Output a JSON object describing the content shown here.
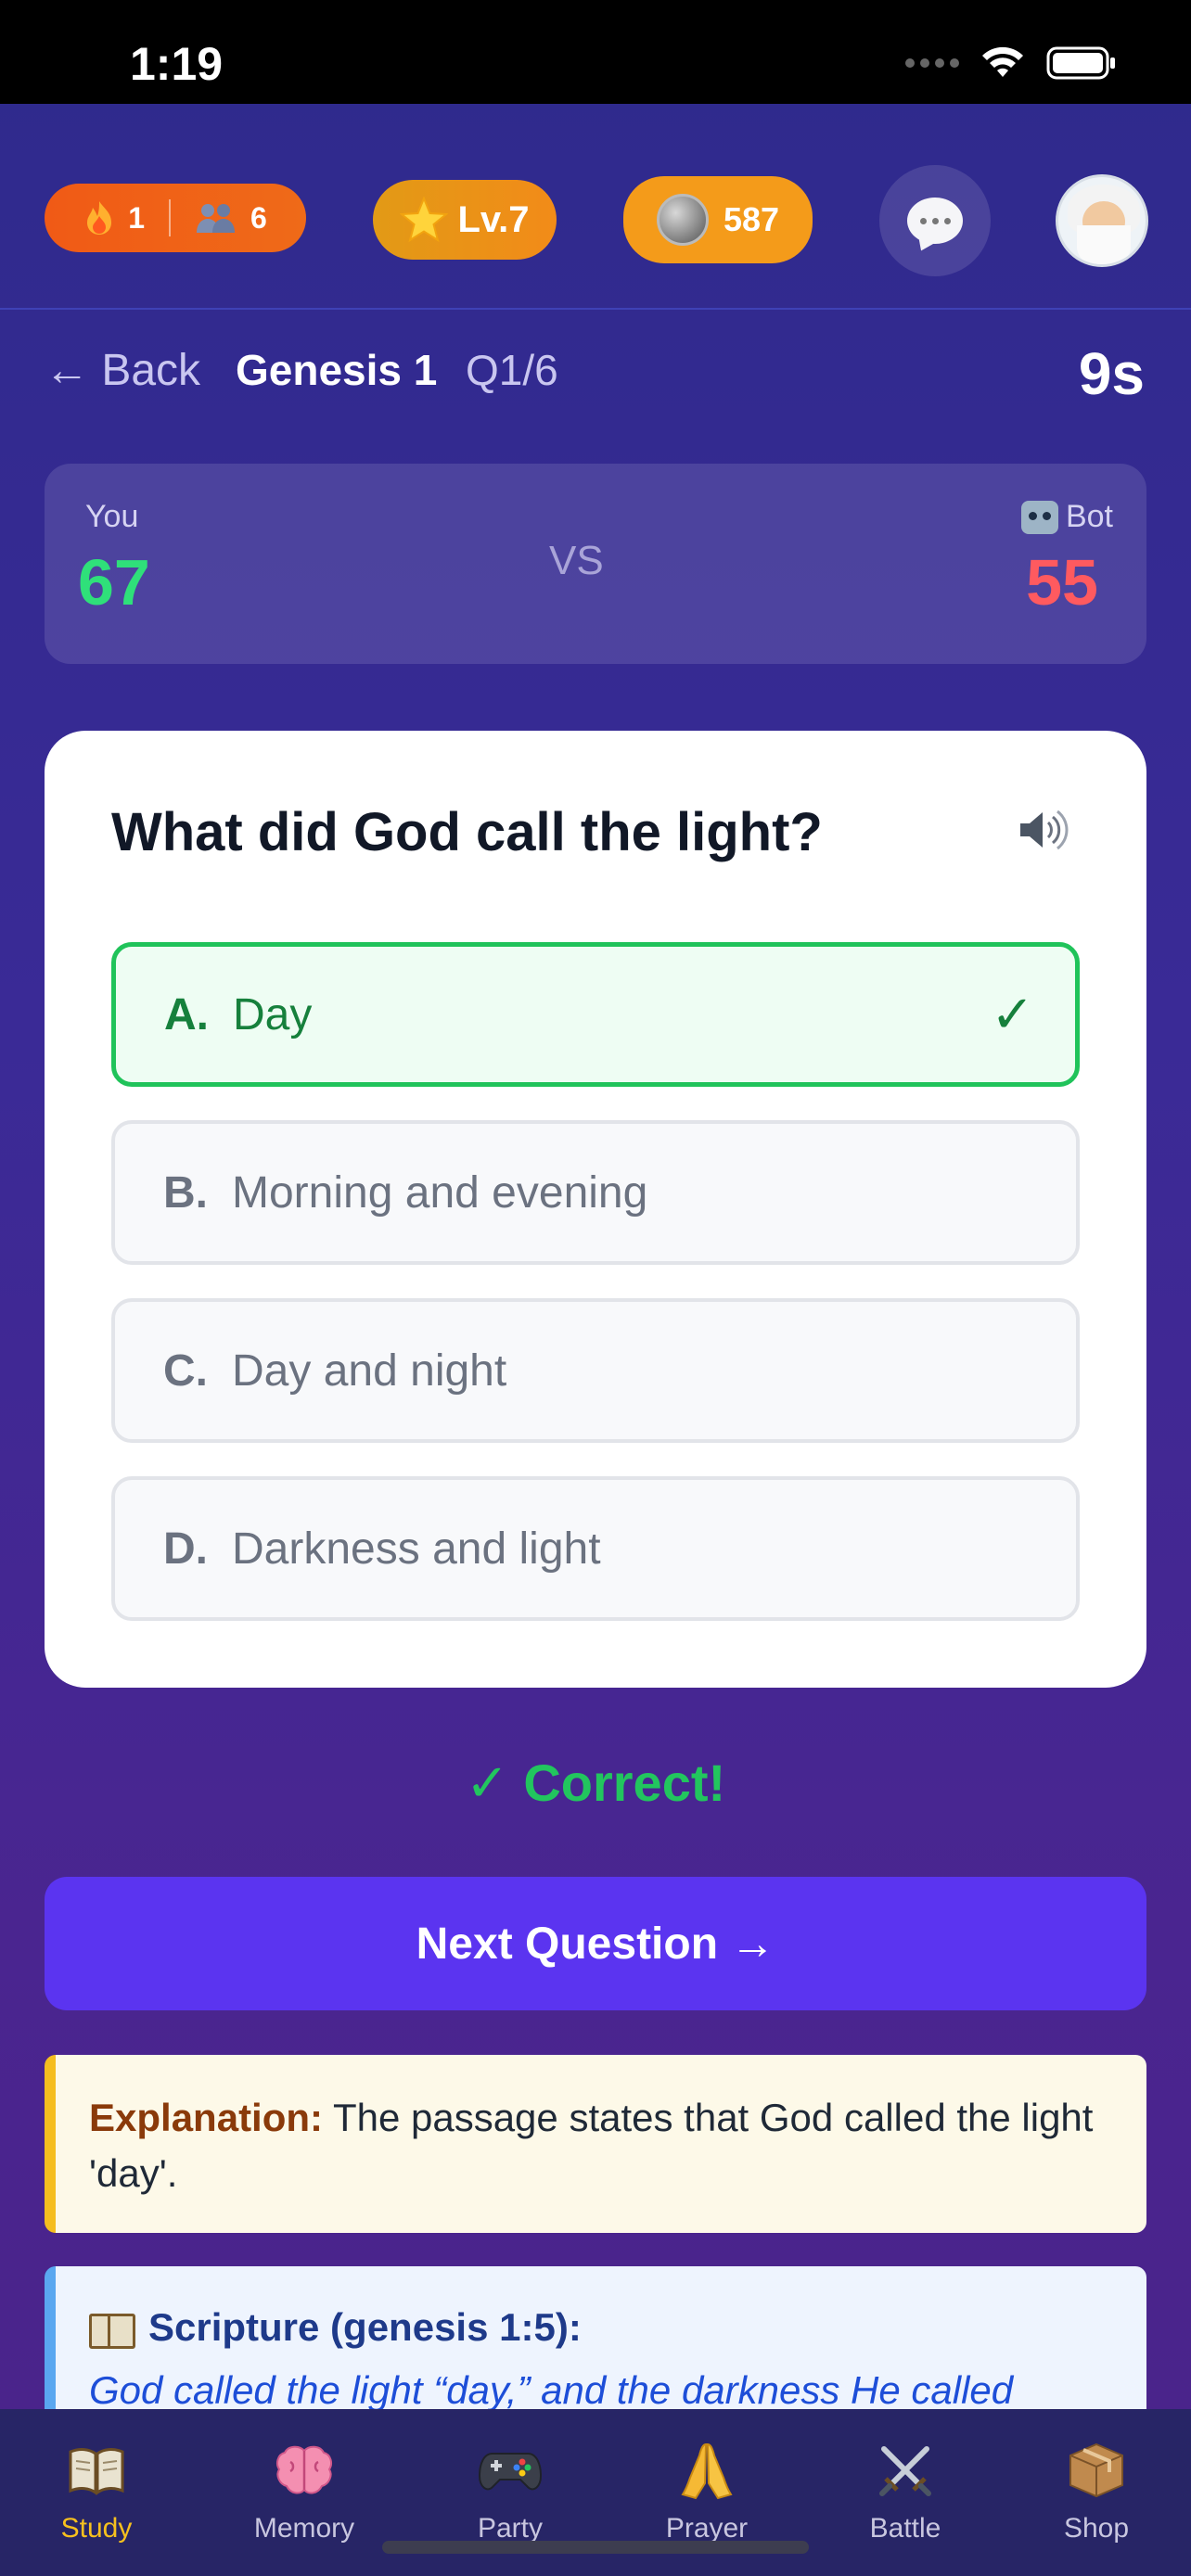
{
  "status_bar": {
    "time": "1:19"
  },
  "header": {
    "streak_count": "1",
    "friends_count": "6",
    "level": "Lv.7",
    "coins": "587"
  },
  "nav": {
    "back_label": "← Back",
    "chapter": "Genesis 1",
    "question_counter": "Q1/6",
    "timer": "9s"
  },
  "scoreboard": {
    "you_label": "You",
    "you_score": "67",
    "vs_label": "VS",
    "bot_label": "Bot",
    "bot_score": "55"
  },
  "question": {
    "text": "What did God call the light?",
    "options": [
      {
        "letter": "A.",
        "text": "Day",
        "state": "correct"
      },
      {
        "letter": "B.",
        "text": "Morning and evening",
        "state": "default"
      },
      {
        "letter": "C.",
        "text": "Day and night",
        "state": "default"
      },
      {
        "letter": "D.",
        "text": "Darkness and light",
        "state": "default"
      }
    ],
    "check_mark": "✓"
  },
  "feedback": {
    "text": "✓ Correct!"
  },
  "next_button": {
    "label": "Next Question →"
  },
  "explanation": {
    "label": "Explanation:",
    "text": " The passage states that God called the light 'day'."
  },
  "scripture": {
    "title": "Scripture (genesis 1:5):",
    "text": "God called the light “day,” and the darkness He called"
  },
  "tabs": [
    {
      "label": "Study",
      "icon": "open-book-icon",
      "active": true
    },
    {
      "label": "Memory",
      "icon": "brain-icon",
      "active": false
    },
    {
      "label": "Party",
      "icon": "gamepad-icon",
      "active": false
    },
    {
      "label": "Prayer",
      "icon": "praying-hands-icon",
      "active": false
    },
    {
      "label": "Battle",
      "icon": "crossed-swords-icon",
      "active": false
    },
    {
      "label": "Shop",
      "icon": "package-icon",
      "active": false
    }
  ],
  "colors": {
    "correct_green": "#22c55e",
    "bot_red": "#ff5a5f",
    "primary_button": "#5b34f0",
    "active_tab": "#f6c01e"
  }
}
